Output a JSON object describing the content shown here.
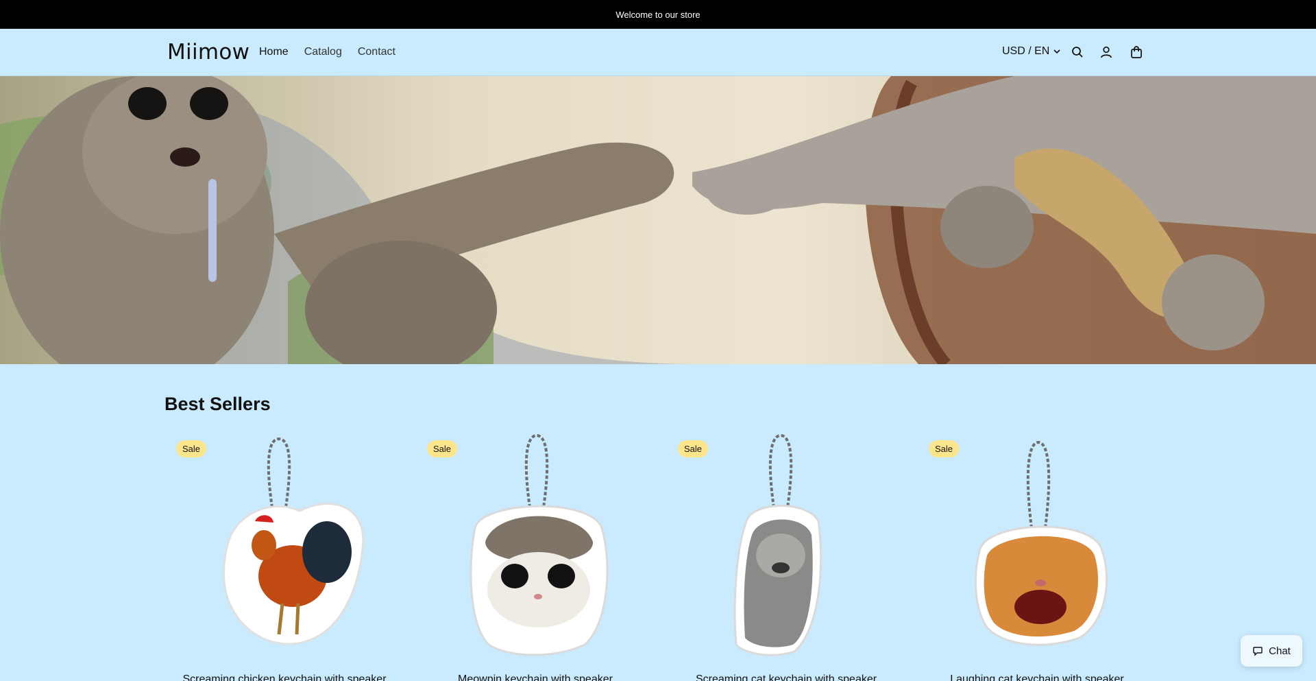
{
  "announcement": {
    "text": "Welcome to our store"
  },
  "header": {
    "logo": "Miimow",
    "nav": [
      {
        "label": "Home",
        "active": true
      },
      {
        "label": "Catalog",
        "active": false
      },
      {
        "label": "Contact",
        "active": false
      }
    ],
    "localization": "USD / EN",
    "icons": [
      "chevron-down-icon",
      "search-icon",
      "account-icon",
      "cart-icon"
    ]
  },
  "hero": {
    "image": "cats-creation-of-adam-banner"
  },
  "best_sellers": {
    "title": "Best Sellers",
    "products": [
      {
        "badge": "Sale",
        "title": "Screaming chicken keychain with speaker",
        "image": "rooster-keychain"
      },
      {
        "badge": "Sale",
        "title": "Meowpin keychain with speaker",
        "image": "wide-eyed-cat-keychain"
      },
      {
        "badge": "Sale",
        "title": "Screaming cat keychain with speaker",
        "image": "screaming-tabby-keychain"
      },
      {
        "badge": "Sale",
        "title": "Laughing cat keychain with speaker",
        "image": "laughing-orange-cat-keychain"
      }
    ]
  },
  "chat": {
    "label": "Chat"
  },
  "colors": {
    "page_bg": "#c9ebfd",
    "announcement_bg": "#000000",
    "badge_bg": "#fde58c"
  }
}
